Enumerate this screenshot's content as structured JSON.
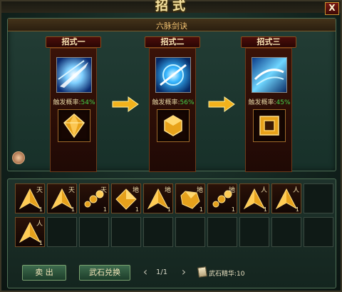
{
  "window": {
    "title": "招式",
    "close_label": "X"
  },
  "section": {
    "title": "六脉剑诀"
  },
  "slots": [
    {
      "label": "招式一",
      "rate_label": "触发概率:",
      "rate_value": "54%",
      "skill_icon": "blue-slash-skill-icon",
      "gem_icon": "gold-diamond-gem-icon"
    },
    {
      "label": "招式二",
      "rate_label": "触发概率:",
      "rate_value": "56%",
      "skill_icon": "blue-vortex-skill-icon",
      "gem_icon": "gold-hexagon-gem-icon"
    },
    {
      "label": "招式三",
      "rate_label": "触发概率:",
      "rate_value": "45%",
      "skill_icon": "blue-sweep-skill-icon",
      "gem_icon": "gold-square-gem-icon"
    }
  ],
  "inventory": {
    "items": [
      {
        "tag": "天",
        "count": "1",
        "icon": "tri-star-gem-icon"
      },
      {
        "tag": "天",
        "count": "1",
        "icon": "tri-star-gem-icon"
      },
      {
        "tag": "天",
        "count": "1",
        "icon": "cluster-gem-icon"
      },
      {
        "tag": "地",
        "count": "1",
        "icon": "diamond-gem-icon"
      },
      {
        "tag": "地",
        "count": "1",
        "icon": "tri-star-gem-icon"
      },
      {
        "tag": "地",
        "count": "1",
        "icon": "nugget-gem-icon"
      },
      {
        "tag": "地",
        "count": "1",
        "icon": "cluster-gem-icon"
      },
      {
        "tag": "人",
        "count": "1",
        "icon": "tri-star-gem-icon"
      },
      {
        "tag": "人",
        "count": "1",
        "icon": "tri-star-gem-icon"
      }
    ]
  },
  "buttons": {
    "sell": "卖 出",
    "exchange": "武石兑换"
  },
  "pager": {
    "page": "1/1",
    "prev": "‹",
    "next": "›"
  },
  "essence": {
    "label": "武石精华:",
    "value": "10"
  }
}
